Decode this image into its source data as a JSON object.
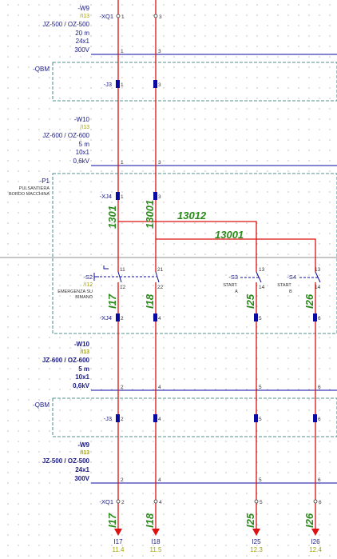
{
  "colors": {
    "wire": "#dd1111",
    "bus": "#0a0aa0",
    "frame": "#1a6d6d",
    "device": "#0a0aa0",
    "wire_label": "#2a8a1a",
    "text": "#1a1a80",
    "ref": "#a3a300",
    "grid": "#9a9a9a"
  },
  "cables": [
    {
      "id": "-W9",
      "ref": "/I13",
      "type": "JZ-500 / OZ-500",
      "length": "20 m",
      "cores": "24x1",
      "voltage": "300V"
    },
    {
      "id": "-W10",
      "ref": "/I13",
      "type": "JZ-600 / OZ-600",
      "length": "5 m",
      "cores": "10x1",
      "voltage": "0,6kV"
    },
    {
      "id": "-W10",
      "ref": "/I13",
      "type": "JZ-600 / OZ-600",
      "length": "5 m",
      "cores": "10x1",
      "voltage": "0,6kV"
    },
    {
      "id": "-W9",
      "ref": "/I13",
      "type": "JZ-500 / OZ-500",
      "length": "",
      "cores": "24x1",
      "voltage": "300V"
    }
  ],
  "boxes": [
    {
      "id": "-QBM",
      "sub1": "",
      "sub2": ""
    },
    {
      "id": "-P1",
      "sub1": "PULSANTIERA",
      "sub2": "BORDO MACCHINA"
    },
    {
      "id": "-QBM",
      "sub1": "",
      "sub2": ""
    }
  ],
  "terminal_tags": {
    "xq1_top": "-XQ1",
    "j3_a": "-J3",
    "xj4_a": "-XJ4",
    "xj4_b": "-XJ4",
    "j3_b": "-J3",
    "xq1_bottom": "-XQ1"
  },
  "pin_numbers": {
    "p1": "1",
    "p3": "3",
    "p2": "2",
    "p4": "4",
    "p5": "5",
    "p6": "6",
    "c11": "11",
    "c12": "12",
    "c21": "21",
    "c22": "22",
    "c13a": "13",
    "c14a": "14",
    "c13b": "13",
    "c14b": "14"
  },
  "devices": {
    "s2": {
      "id": "-S2",
      "ref": "/I12",
      "desc1": "EMERGENZA SU",
      "desc2": "BIMANO"
    },
    "s3": {
      "id": "-S3",
      "desc1": "START",
      "desc2": "A"
    },
    "s4": {
      "id": "-S4",
      "desc1": "START",
      "desc2": "B"
    }
  },
  "wire_labels": {
    "w1301": "1301",
    "w13001_v": "13001",
    "w13012": "13012",
    "w13001_h": "13001",
    "i17": "I17",
    "i18": "I18",
    "i25": "I25",
    "i26": "I26",
    "i17b": "I17",
    "i18b": "I18",
    "i25b": "I25",
    "i26b": "I26"
  },
  "destinations": [
    {
      "name": "I17",
      "ref": "11.4"
    },
    {
      "name": "I18",
      "ref": "11.5"
    },
    {
      "name": "I25",
      "ref": "12.3"
    },
    {
      "name": "I26",
      "ref": "12.4"
    }
  ]
}
